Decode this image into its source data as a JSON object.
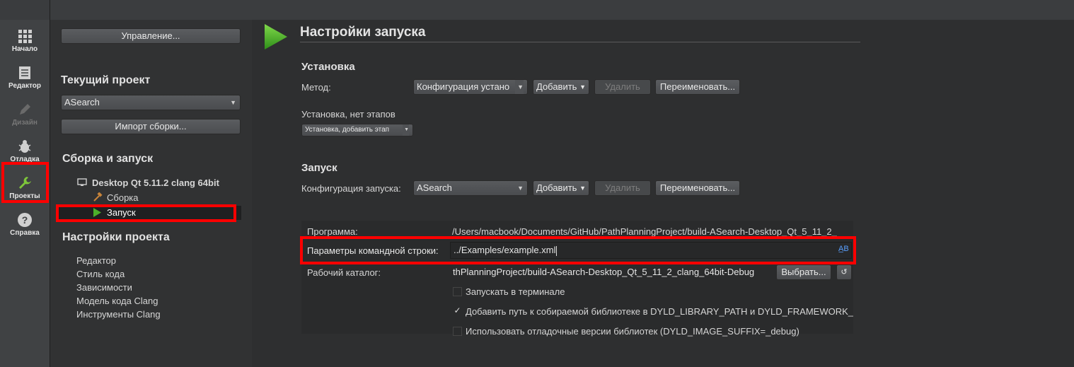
{
  "modes": [
    {
      "label": "Начало",
      "icon": "grid-icon"
    },
    {
      "label": "Редактор",
      "icon": "document-icon"
    },
    {
      "label": "Дизайн",
      "icon": "pen-icon"
    },
    {
      "label": "Отладка",
      "icon": "bug-icon"
    },
    {
      "label": "Проекты",
      "icon": "wrench-icon"
    },
    {
      "label": "Справка",
      "icon": "help-icon"
    }
  ],
  "nav": {
    "manage_button": "Управление...",
    "current_project_heading": "Текущий проект",
    "project_select": "ASearch",
    "import_button": "Импорт сборки...",
    "build_run_heading": "Сборка и запуск",
    "kit_name": "Desktop Qt 5.11.2 clang 64bit",
    "build_item": "Сборка",
    "run_item": "Запуск",
    "project_settings_heading": "Настройки проекта",
    "settings_items": [
      "Редактор",
      "Стиль кода",
      "Зависимости",
      "Модель кода Clang",
      "Инструменты Clang"
    ]
  },
  "main": {
    "title": "Настройки запуска",
    "deploy": {
      "heading": "Установка",
      "method_label": "Метод:",
      "method_value": "Конфигурация устано",
      "add_button": "Добавить",
      "remove_button": "Удалить",
      "rename_button": "Переименовать...",
      "steps_label": "Установка, нет этапов",
      "add_step": "Установка, добавить этап"
    },
    "run": {
      "heading": "Запуск",
      "config_label": "Конфигурация запуска:",
      "config_value": "ASearch",
      "add_button": "Добавить",
      "remove_button": "Удалить",
      "rename_button": "Переименовать...",
      "program_label": "Программа:",
      "program_value": "/Users/macbook/Documents/GitHub/PathPlanningProject/build-ASearch-Desktop_Qt_5_11_2_",
      "args_label": "Параметры командной строки:",
      "args_value": "../Examples/example.xml",
      "workdir_label": "Рабочий каталог:",
      "workdir_value": "thPlanningProject/build-ASearch-Desktop_Qt_5_11_2_clang_64bit-Debug",
      "browse_button": "Выбрать...",
      "run_in_terminal": "Запускать в терминале",
      "add_dyld": "Добавить путь к собираемой библиотеке в DYLD_LIBRARY_PATH и DYLD_FRAMEWORK_",
      "use_debug": "Использовать отладочные версии библиотек (DYLD_IMAGE_SUFFIX=_debug)"
    }
  },
  "colors": {
    "highlight": "#ff0000",
    "run_green": "#4caf2a"
  }
}
